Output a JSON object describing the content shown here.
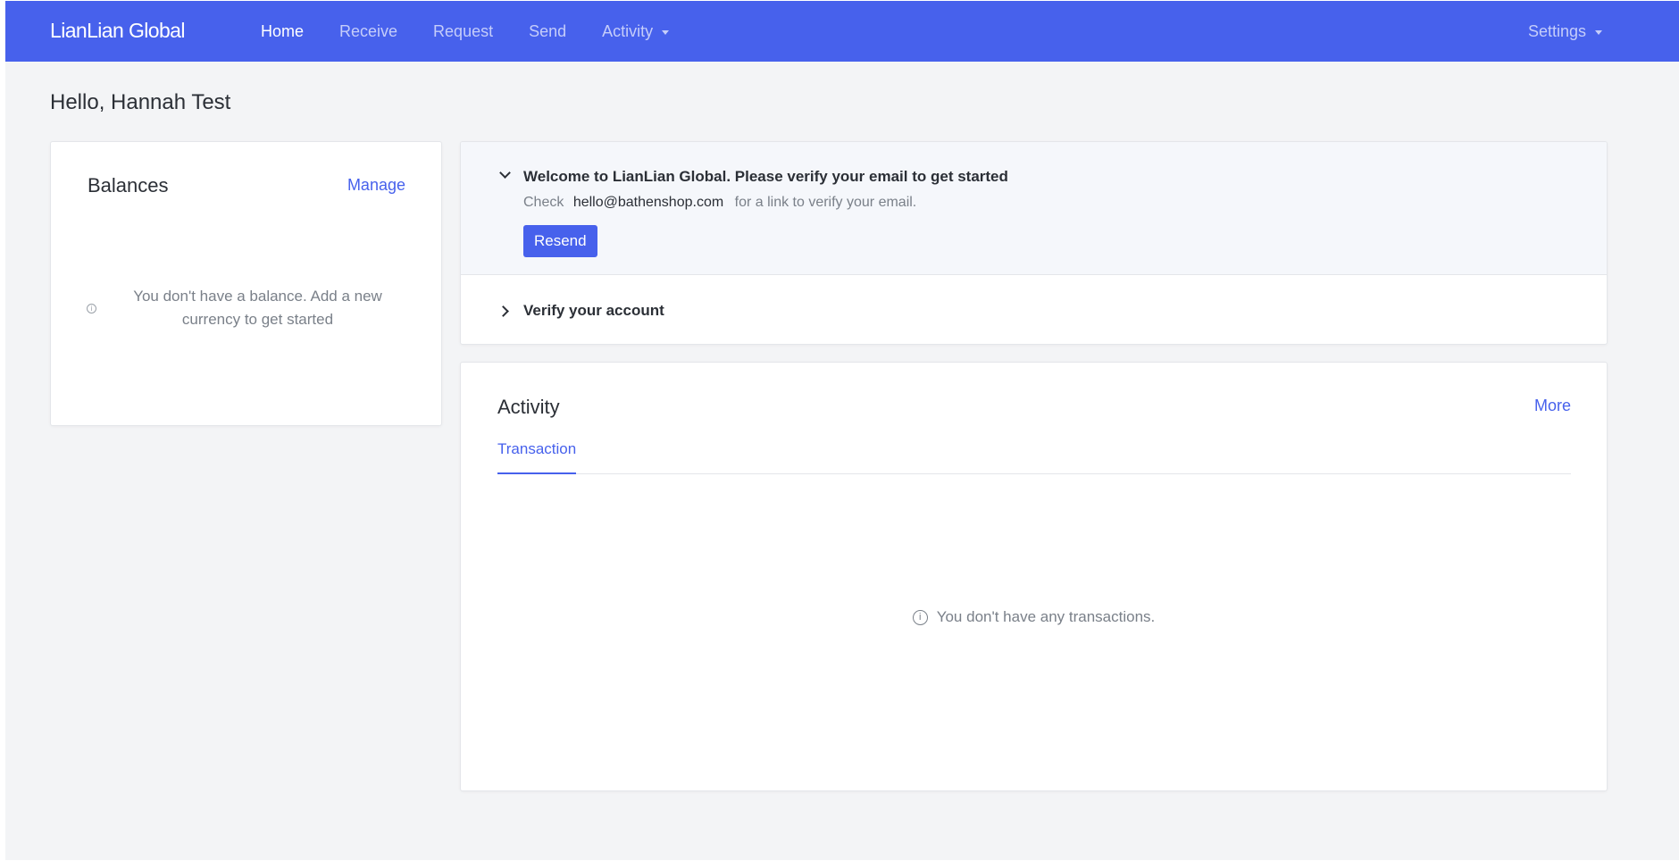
{
  "nav": {
    "brand": "LianLian Global",
    "links": [
      {
        "label": "Home",
        "active": true
      },
      {
        "label": "Receive",
        "active": false
      },
      {
        "label": "Request",
        "active": false
      },
      {
        "label": "Send",
        "active": false
      },
      {
        "label": "Activity",
        "active": false,
        "dropdown": true
      }
    ],
    "settings_label": "Settings"
  },
  "greeting": "Hello, Hannah Test",
  "balances": {
    "title": "Balances",
    "manage_label": "Manage",
    "empty_text": "You don't have a balance. Add a new currency to get started",
    "icon": "info-icon"
  },
  "verify": {
    "email_title": "Welcome to LianLian Global. Please verify your email to get started",
    "check_prefix": "Check",
    "email": "hello@bathenshop.com",
    "check_suffix": "for a link to verify your email.",
    "resend_label": "Resend",
    "account_title": "Verify your account"
  },
  "activity": {
    "title": "Activity",
    "more_label": "More",
    "tabs": [
      {
        "label": "Transaction",
        "active": true
      }
    ],
    "empty_text": "You don't have any transactions."
  },
  "colors": {
    "brand": "#4761ec",
    "background": "#f3f4f6",
    "card": "#ffffff"
  }
}
